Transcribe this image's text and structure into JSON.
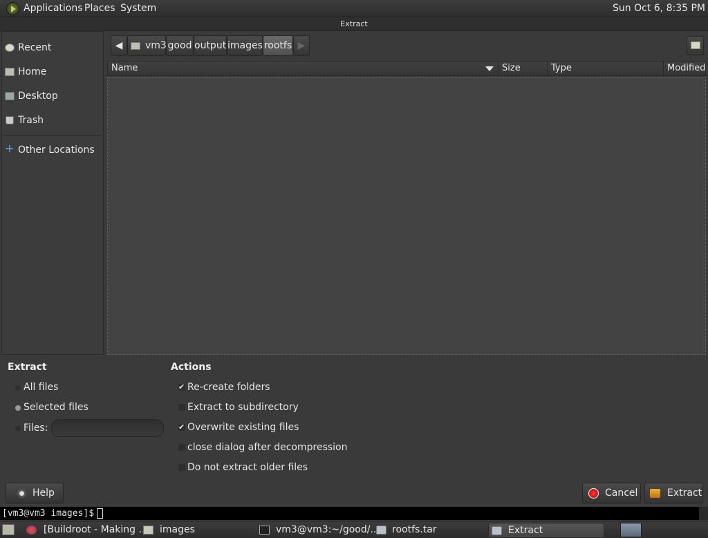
{
  "top_panel": {
    "menus": [
      "Applications",
      "Places",
      "System"
    ],
    "clock": "Sun Oct  6,  8:35 PM"
  },
  "window": {
    "title": "Extract"
  },
  "sidebar": {
    "items": [
      {
        "label": "Recent",
        "icon": "clock-icon"
      },
      {
        "label": "Home",
        "icon": "home-folder-icon"
      },
      {
        "label": "Desktop",
        "icon": "desktop-folder-icon"
      },
      {
        "label": "Trash",
        "icon": "trash-icon"
      },
      {
        "label": "Other Locations",
        "icon": "plus-icon"
      }
    ]
  },
  "pathbar": {
    "segments": [
      "vm3",
      "good",
      "output",
      "images",
      "rootfs"
    ],
    "active": "rootfs"
  },
  "file_list": {
    "columns": [
      "Name",
      "Size",
      "Type",
      "Modified"
    ],
    "sort_column": "Name",
    "rows": []
  },
  "extract_section": {
    "title": "Extract",
    "options": [
      {
        "label": "All files",
        "selected": false
      },
      {
        "label": "Selected files",
        "selected": true
      },
      {
        "label": "Files:",
        "selected": false
      }
    ],
    "files_value": ""
  },
  "actions_section": {
    "title": "Actions",
    "options": [
      {
        "label": "Re-create folders",
        "checked": true
      },
      {
        "label": "Extract to subdirectory",
        "checked": false
      },
      {
        "label": "Overwrite existing files",
        "checked": true
      },
      {
        "label": "close dialog after decompression",
        "checked": false
      },
      {
        "label": "Do not extract older files",
        "checked": false
      }
    ]
  },
  "buttons": {
    "help": "Help",
    "cancel": "Cancel",
    "extract": "Extract"
  },
  "terminal": {
    "prompt": "[vm3@vm3 images]$"
  },
  "taskbar": {
    "tasks": [
      {
        "label": "[Buildroot - Making ...",
        "icon": "firefox-icon"
      },
      {
        "label": "images",
        "icon": "folder-icon"
      },
      {
        "label": "vm3@vm3:~/good/...",
        "icon": "terminal-icon"
      },
      {
        "label": "rootfs.tar",
        "icon": "archive-icon"
      },
      {
        "label": "Extract",
        "icon": "archive-icon",
        "active": true
      }
    ]
  }
}
